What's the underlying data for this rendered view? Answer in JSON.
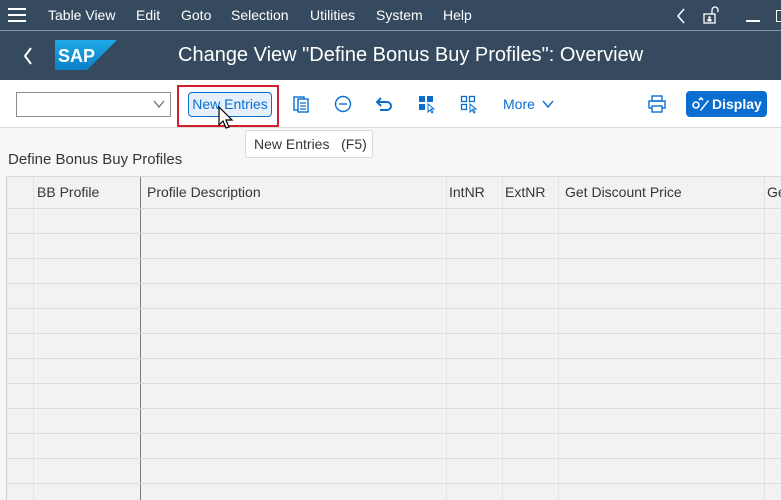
{
  "menubar": {
    "items": [
      {
        "label": "Table View"
      },
      {
        "label": "Edit"
      },
      {
        "label": "Goto"
      },
      {
        "label": "Selection"
      },
      {
        "label": "Utilities"
      },
      {
        "label": "System"
      },
      {
        "label": "Help"
      }
    ]
  },
  "shell": {
    "logo": "SAP",
    "title": "Change View \"Define Bonus Buy Profiles\": Overview"
  },
  "toolbar": {
    "dropdown_value": "",
    "new_entries_label": "New Entries",
    "more_label": "More",
    "display_label": "Display"
  },
  "tooltip": {
    "text": "New Entries   (F5)"
  },
  "section": {
    "title": "Define Bonus Buy Profiles"
  },
  "table": {
    "columns": [
      "",
      "BB Profile",
      "Profile Description",
      "IntNR",
      "ExtNR",
      "Get Discount Price",
      "Ge"
    ],
    "rows": []
  },
  "colors": {
    "shell_bg": "#354a5f",
    "accent": "#0a6ed1",
    "highlight_border": "#d0202b",
    "sap_logo": "#0a9ed9"
  }
}
